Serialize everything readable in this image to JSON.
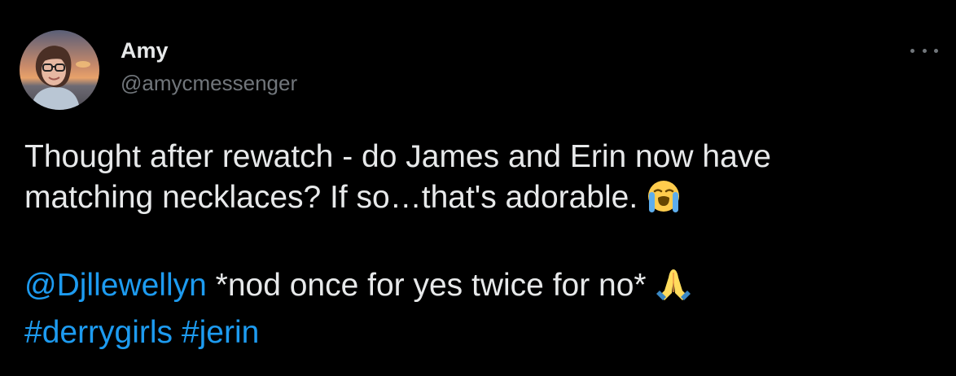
{
  "author": {
    "name": "Amy",
    "handle": "@amycmessenger",
    "avatar_icon": "profile-photo"
  },
  "more_icon": "more-dots-icon",
  "tweet": {
    "line1": "Thought after rewatch - do James and Erin now have",
    "line2": "matching necklaces? If so…that's adorable.",
    "emoji1": "loudly-crying-face-emoji",
    "mention": "@Djllewellyn",
    "line3_rest": " *nod once for yes twice for no*",
    "emoji2": "folded-hands-emoji",
    "hashtag1": "#derrygirls",
    "hashtag2": "#jerin"
  },
  "colors": {
    "background": "#000000",
    "text": "#e7e9ea",
    "secondary": "#71767b",
    "link": "#1d9bf0"
  }
}
